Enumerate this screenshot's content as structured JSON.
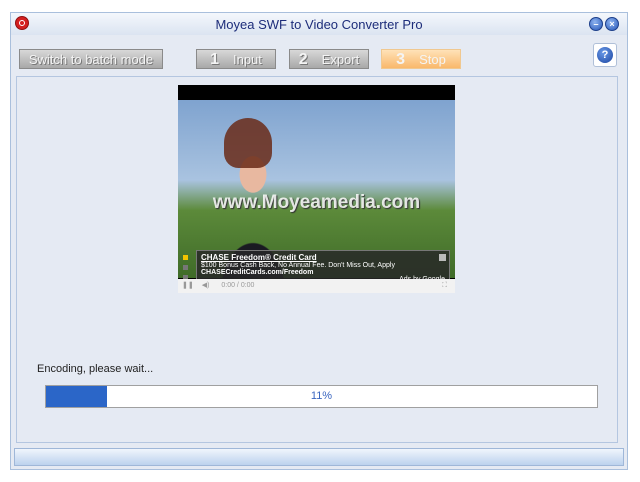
{
  "window": {
    "title": "Moyea SWF to Video Converter Pro"
  },
  "toolbar": {
    "batch_label": "Switch to batch mode",
    "steps": [
      {
        "num": "1",
        "label": "Input"
      },
      {
        "num": "2",
        "label": "Export"
      },
      {
        "num": "3",
        "label": "Stop"
      }
    ],
    "help_label": "?"
  },
  "preview": {
    "watermark": "www.Moyeamedia.com",
    "ad_title": "CHASE Freedom® Credit Card",
    "ad_line": "$100 Bonus Cash Back, No Annual Fee. Don't Miss Out, Apply",
    "ad_link": "CHASECreditCards.com/Freedom",
    "ad_credit": "Ads by Google",
    "time": "0:00 / 0:00"
  },
  "progress": {
    "status": "Encoding, please wait...",
    "percent": 11,
    "label": "11%"
  },
  "colors": {
    "accent": "#2b66c8",
    "active_step": "#f9b86c"
  }
}
